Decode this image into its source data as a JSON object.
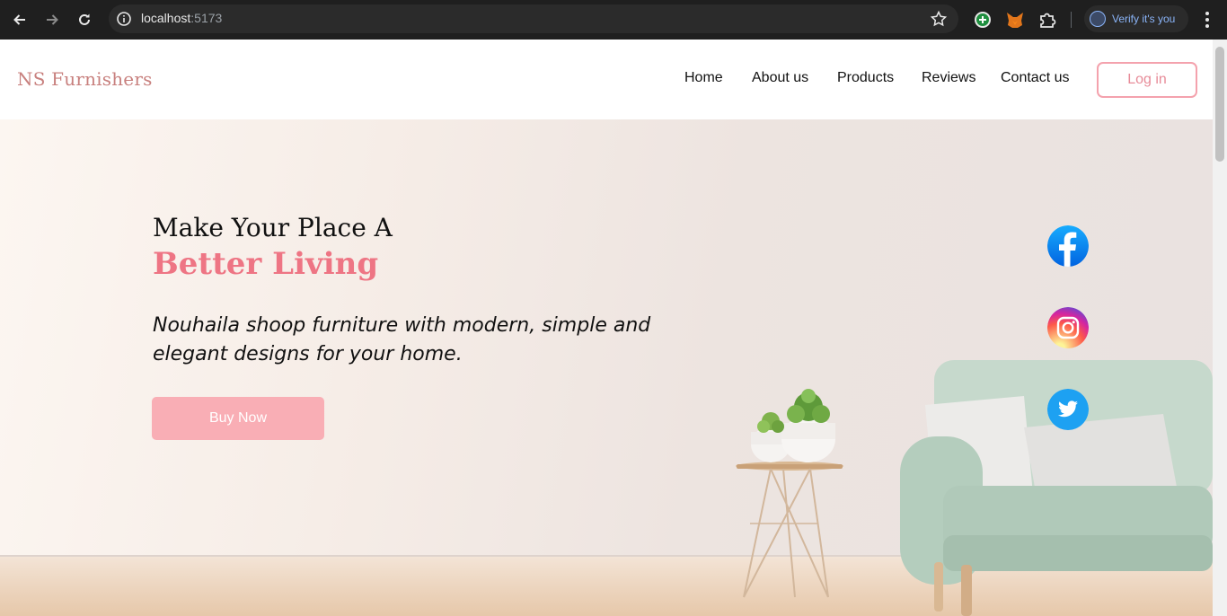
{
  "browser": {
    "url_host": "localhost",
    "url_port": ":5173",
    "profile_label": "Verify it's you",
    "icons": [
      "back-icon",
      "forward-icon",
      "reload-icon",
      "site-info-icon",
      "bookmark-star-icon",
      "extension-add-icon",
      "metamask-fox-icon",
      "extensions-puzzle-icon",
      "profile-avatar-icon",
      "menu-kebab-icon"
    ]
  },
  "navbar": {
    "brand": "NS Furnishers",
    "links": [
      "Home",
      "About us",
      "Products",
      "Reviews",
      "Contact us"
    ],
    "login_label": "Log in"
  },
  "hero": {
    "title_line1": "Make Your Place A",
    "title_line2": "Better Living",
    "subtitle": "Nouhaila shoop furniture with modern, simple and elegant designs for your home.",
    "cta_label": "Buy Now"
  },
  "social": [
    {
      "name": "facebook",
      "icon": "facebook-icon",
      "color": "#1877f2"
    },
    {
      "name": "instagram",
      "icon": "instagram-icon",
      "color": "#d6249f"
    },
    {
      "name": "twitter",
      "icon": "twitter-icon",
      "color": "#1da1f2"
    }
  ],
  "colors": {
    "accent": "#ee7584",
    "brand": "#c8807e",
    "button": "#f9aeb5",
    "login_border": "#f4a2ad"
  }
}
